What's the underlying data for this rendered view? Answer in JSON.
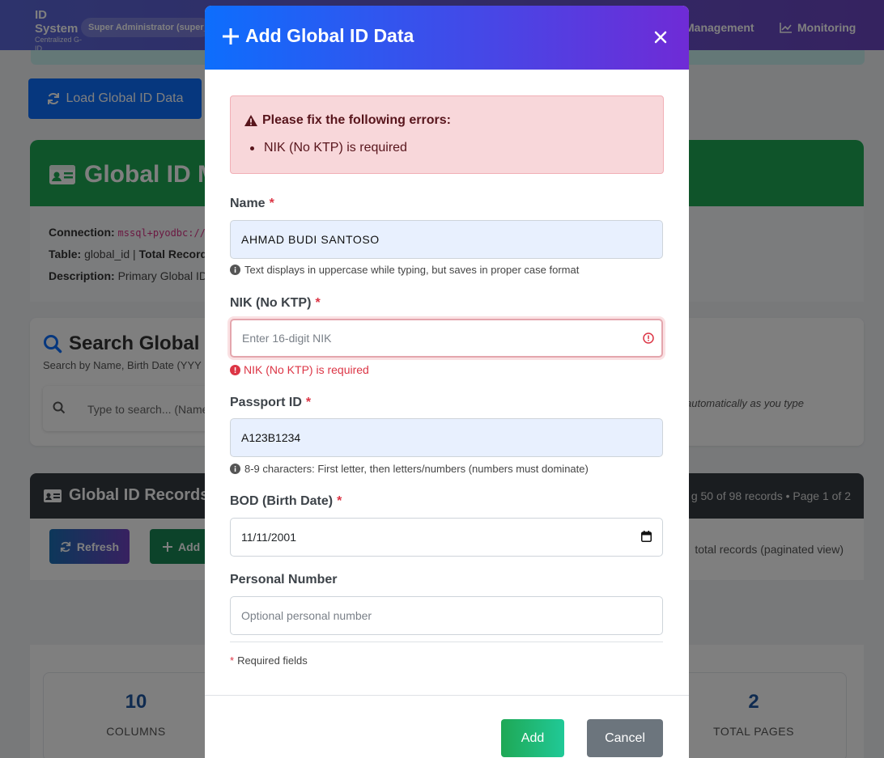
{
  "navbar": {
    "brand": "ID System",
    "brand_sub": "Centralized G-ID Management",
    "role": "Super Administrator (super_admin)",
    "links": [
      "Management",
      "Monitoring"
    ]
  },
  "page": {
    "load_button": "Load Global ID Data",
    "hero_title": "Global ID M",
    "connection_label": "Connection:",
    "connection_value": "mssql+pyodbc://s",
    "table_label": "Table:",
    "table_value": "global_id |",
    "total_records_label": "Total Record",
    "description_label": "Description:",
    "description_value": "Primary Global ID",
    "search_title": "Search Global ID",
    "search_sub": "Search by Name, Birth Date (YYY",
    "search_placeholder": "Type to search... (Name",
    "search_hint": "automatically as you type",
    "records_title": "Global ID Records",
    "records_info": "g 50 of 98 records • Page 1 of 2",
    "refresh_button": "Refresh",
    "add_record_button": "Add",
    "records_note": "total records (paginated view)",
    "stats": [
      {
        "value": "10",
        "label": "COLUMNS"
      },
      {
        "value": "2",
        "label": "TOTAL PAGES"
      }
    ]
  },
  "modal": {
    "title": "Add Global ID Data",
    "alert": {
      "title": "Please fix the following errors:",
      "items": [
        "NIK (No KTP) is required"
      ]
    },
    "fields": {
      "name": {
        "label": "Name",
        "required": "*",
        "value": "AHMAD BUDI SANTOSO",
        "help": "Text displays in uppercase while typing, but saves in proper case format"
      },
      "nik": {
        "label": "NIK (No KTP)",
        "required": "*",
        "placeholder": "Enter 16-digit NIK",
        "error": "NIK (No KTP) is required"
      },
      "passport": {
        "label": "Passport ID",
        "required": "*",
        "value": "A123B1234",
        "help": "8-9 characters: First letter, then letters/numbers (numbers must dominate)"
      },
      "bod": {
        "label": "BOD (Birth Date)",
        "required": "*",
        "value": "11/11/2001"
      },
      "personal_number": {
        "label": "Personal Number",
        "placeholder": "Optional personal number"
      }
    },
    "required_note_star": "*",
    "required_note": "Required fields",
    "add_button": "Add",
    "cancel_button": "Cancel"
  },
  "colors": {
    "primary": "#0d6efd",
    "header_gradient_end": "#6f2bd6",
    "danger": "#dc3545",
    "success": "#1fa855",
    "secondary": "#6c757d"
  }
}
